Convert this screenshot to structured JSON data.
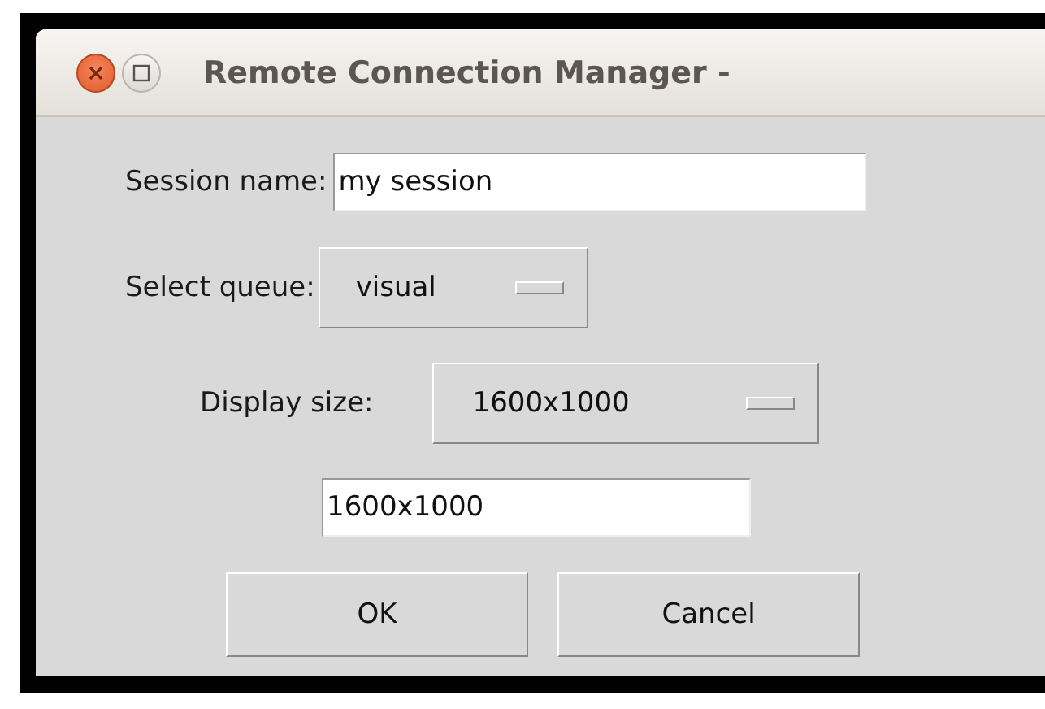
{
  "window": {
    "title": "Remote Connection Manager -"
  },
  "session_name": {
    "label": "Session name:",
    "value": "my session"
  },
  "queue": {
    "label": "Select queue:",
    "value": "visual"
  },
  "display_size": {
    "label": "Display size:",
    "value": "1600x1000"
  },
  "display_size_entry": {
    "value": "1600x1000"
  },
  "buttons": [
    "OK",
    "Cancel"
  ]
}
